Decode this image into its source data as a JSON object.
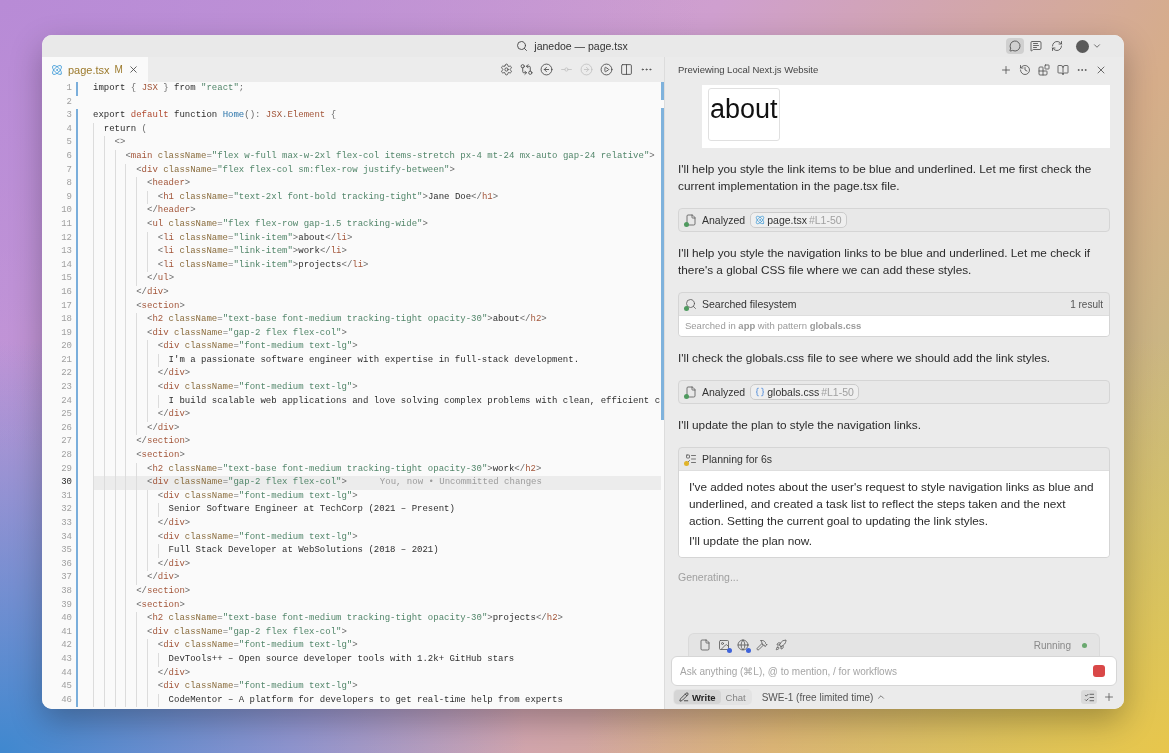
{
  "title_bar": {
    "title": "janedoe — page.tsx",
    "toggles": [
      {
        "selected": true
      },
      {
        "selected": false
      },
      {
        "selected": false
      }
    ]
  },
  "editor": {
    "tabs": [
      {
        "label": "page.tsx",
        "status": "M",
        "modified": true,
        "selected": true
      }
    ],
    "actions": [
      {
        "disabled": false
      },
      {
        "disabled": false
      },
      {
        "disabled": false
      },
      {
        "disabled": true
      },
      {
        "disabled": true
      },
      {
        "disabled": false
      },
      {
        "disabled": false
      },
      {
        "disabled": false
      }
    ],
    "lines": [
      {
        "number": "1",
        "changed": true,
        "current": false,
        "tokens": [
          {
            "kind": "text",
            "text": "import "
          },
          {
            "kind": "punct",
            "text": "{ "
          },
          {
            "kind": "type",
            "text": "JSX"
          },
          {
            "kind": "punct",
            "text": " } "
          },
          {
            "kind": "text",
            "text": "from "
          },
          {
            "kind": "string",
            "text": "\"react\""
          },
          {
            "kind": "punct",
            "text": ";"
          }
        ]
      },
      {
        "number": "2",
        "changed": false,
        "current": false
      },
      {
        "number": "3",
        "changed": true,
        "current": false,
        "tokens": [
          {
            "kind": "text",
            "text": "export "
          },
          {
            "kind": "keyword",
            "text": "default"
          },
          {
            "kind": "text",
            "text": " function "
          },
          {
            "kind": "name",
            "text": "Home"
          },
          {
            "kind": "punct",
            "text": "(): "
          },
          {
            "kind": "type",
            "text": "JSX"
          },
          {
            "kind": "punct",
            "text": "."
          },
          {
            "kind": "type",
            "text": "Element"
          },
          {
            "kind": "punct",
            "text": " {"
          }
        ]
      },
      {
        "number": "4",
        "changed": true,
        "current": false,
        "tokens": [
          {
            "kind": "text",
            "text": "  return "
          },
          {
            "kind": "punct",
            "text": "("
          }
        ]
      },
      {
        "number": "5",
        "changed": true,
        "current": false,
        "tokens": [
          {
            "kind": "punct",
            "text": "    <>"
          }
        ]
      },
      {
        "number": "6",
        "changed": true,
        "current": false,
        "tokens": [
          {
            "kind": "punct",
            "text": "      <"
          },
          {
            "kind": "tag",
            "text": "main"
          },
          {
            "kind": "attr",
            "text": " className"
          },
          {
            "kind": "punct",
            "text": "="
          },
          {
            "kind": "string",
            "text": "\"flex w-full max-w-2xl flex-col items-stretch px-4 mt-24 mx-auto gap-24 relative\""
          },
          {
            "kind": "punct",
            "text": ">"
          }
        ]
      },
      {
        "number": "7",
        "changed": true,
        "current": false,
        "tokens": [
          {
            "kind": "punct",
            "text": "        <"
          },
          {
            "kind": "tag",
            "text": "div"
          },
          {
            "kind": "attr",
            "text": " className"
          },
          {
            "kind": "punct",
            "text": "="
          },
          {
            "kind": "string",
            "text": "\"flex flex-col sm:flex-row justify-between\""
          },
          {
            "kind": "punct",
            "text": ">"
          }
        ]
      },
      {
        "number": "8",
        "changed": true,
        "current": false,
        "tokens": [
          {
            "kind": "punct",
            "text": "          <"
          },
          {
            "kind": "tag",
            "text": "header"
          },
          {
            "kind": "punct",
            "text": ">"
          }
        ]
      },
      {
        "number": "9",
        "changed": true,
        "current": false,
        "tokens": [
          {
            "kind": "punct",
            "text": "            <"
          },
          {
            "kind": "tag",
            "text": "h1"
          },
          {
            "kind": "attr",
            "text": " className"
          },
          {
            "kind": "punct",
            "text": "="
          },
          {
            "kind": "string",
            "text": "\"text-2xl font-bold tracking-tight\""
          },
          {
            "kind": "punct",
            "text": ">"
          },
          {
            "kind": "text",
            "text": "Jane Doe"
          },
          {
            "kind": "punct",
            "text": "</"
          },
          {
            "kind": "tag",
            "text": "h1"
          },
          {
            "kind": "punct",
            "text": ">"
          }
        ]
      },
      {
        "number": "10",
        "changed": true,
        "current": false,
        "tokens": [
          {
            "kind": "punct",
            "text": "          </"
          },
          {
            "kind": "tag",
            "text": "header"
          },
          {
            "kind": "punct",
            "text": ">"
          }
        ]
      },
      {
        "number": "11",
        "changed": true,
        "current": false,
        "tokens": [
          {
            "kind": "punct",
            "text": "          <"
          },
          {
            "kind": "tag",
            "text": "ul"
          },
          {
            "kind": "attr",
            "text": " className"
          },
          {
            "kind": "punct",
            "text": "="
          },
          {
            "kind": "string",
            "text": "\"flex flex-row gap-1.5 tracking-wide\""
          },
          {
            "kind": "punct",
            "text": ">"
          }
        ]
      },
      {
        "number": "12",
        "changed": true,
        "current": false,
        "tokens": [
          {
            "kind": "punct",
            "text": "            <"
          },
          {
            "kind": "tag",
            "text": "li"
          },
          {
            "kind": "attr",
            "text": " className"
          },
          {
            "kind": "punct",
            "text": "="
          },
          {
            "kind": "string",
            "text": "\"link-item\""
          },
          {
            "kind": "punct",
            "text": ">"
          },
          {
            "kind": "text",
            "text": "about"
          },
          {
            "kind": "punct",
            "text": "</"
          },
          {
            "kind": "tag",
            "text": "li"
          },
          {
            "kind": "punct",
            "text": ">"
          }
        ]
      },
      {
        "number": "13",
        "changed": true,
        "current": false,
        "tokens": [
          {
            "kind": "punct",
            "text": "            <"
          },
          {
            "kind": "tag",
            "text": "li"
          },
          {
            "kind": "attr",
            "text": " className"
          },
          {
            "kind": "punct",
            "text": "="
          },
          {
            "kind": "string",
            "text": "\"link-item\""
          },
          {
            "kind": "punct",
            "text": ">"
          },
          {
            "kind": "text",
            "text": "work"
          },
          {
            "kind": "punct",
            "text": "</"
          },
          {
            "kind": "tag",
            "text": "li"
          },
          {
            "kind": "punct",
            "text": ">"
          }
        ]
      },
      {
        "number": "14",
        "changed": true,
        "current": false,
        "tokens": [
          {
            "kind": "punct",
            "text": "            <"
          },
          {
            "kind": "tag",
            "text": "li"
          },
          {
            "kind": "attr",
            "text": " className"
          },
          {
            "kind": "punct",
            "text": "="
          },
          {
            "kind": "string",
            "text": "\"link-item\""
          },
          {
            "kind": "punct",
            "text": ">"
          },
          {
            "kind": "text",
            "text": "projects"
          },
          {
            "kind": "punct",
            "text": "</"
          },
          {
            "kind": "tag",
            "text": "li"
          },
          {
            "kind": "punct",
            "text": ">"
          }
        ]
      },
      {
        "number": "15",
        "changed": true,
        "current": false,
        "tokens": [
          {
            "kind": "punct",
            "text": "          </"
          },
          {
            "kind": "tag",
            "text": "ul"
          },
          {
            "kind": "punct",
            "text": ">"
          }
        ]
      },
      {
        "number": "16",
        "changed": true,
        "current": false,
        "tokens": [
          {
            "kind": "punct",
            "text": "        </"
          },
          {
            "kind": "tag",
            "text": "div"
          },
          {
            "kind": "punct",
            "text": ">"
          }
        ]
      },
      {
        "number": "17",
        "changed": true,
        "current": false,
        "tokens": [
          {
            "kind": "punct",
            "text": "        <"
          },
          {
            "kind": "tag",
            "text": "section"
          },
          {
            "kind": "punct",
            "text": ">"
          }
        ]
      },
      {
        "number": "18",
        "changed": true,
        "current": false,
        "tokens": [
          {
            "kind": "punct",
            "text": "          <"
          },
          {
            "kind": "tag",
            "text": "h2"
          },
          {
            "kind": "attr",
            "text": " className"
          },
          {
            "kind": "punct",
            "text": "="
          },
          {
            "kind": "string",
            "text": "\"text-base font-medium tracking-tight opacity-30\""
          },
          {
            "kind": "punct",
            "text": ">"
          },
          {
            "kind": "text",
            "text": "about"
          },
          {
            "kind": "punct",
            "text": "</"
          },
          {
            "kind": "tag",
            "text": "h2"
          },
          {
            "kind": "punct",
            "text": ">"
          }
        ]
      },
      {
        "number": "19",
        "changed": true,
        "current": false,
        "tokens": [
          {
            "kind": "punct",
            "text": "          <"
          },
          {
            "kind": "tag",
            "text": "div"
          },
          {
            "kind": "attr",
            "text": " className"
          },
          {
            "kind": "punct",
            "text": "="
          },
          {
            "kind": "string",
            "text": "\"gap-2 flex flex-col\""
          },
          {
            "kind": "punct",
            "text": ">"
          }
        ]
      },
      {
        "number": "20",
        "changed": true,
        "current": false,
        "tokens": [
          {
            "kind": "punct",
            "text": "            <"
          },
          {
            "kind": "tag",
            "text": "div"
          },
          {
            "kind": "attr",
            "text": " className"
          },
          {
            "kind": "punct",
            "text": "="
          },
          {
            "kind": "string",
            "text": "\"font-medium text-lg\""
          },
          {
            "kind": "punct",
            "text": ">"
          }
        ]
      },
      {
        "number": "21",
        "changed": true,
        "current": false,
        "tokens": [
          {
            "kind": "text",
            "text": "              I'm a passionate software engineer with expertise in full-stack development."
          }
        ]
      },
      {
        "number": "22",
        "changed": true,
        "current": false,
        "tokens": [
          {
            "kind": "punct",
            "text": "            </"
          },
          {
            "kind": "tag",
            "text": "div"
          },
          {
            "kind": "punct",
            "text": ">"
          }
        ]
      },
      {
        "number": "23",
        "changed": true,
        "current": false,
        "tokens": [
          {
            "kind": "punct",
            "text": "            <"
          },
          {
            "kind": "tag",
            "text": "div"
          },
          {
            "kind": "attr",
            "text": " className"
          },
          {
            "kind": "punct",
            "text": "="
          },
          {
            "kind": "string",
            "text": "\"font-medium text-lg\""
          },
          {
            "kind": "punct",
            "text": ">"
          }
        ]
      },
      {
        "number": "24",
        "changed": true,
        "current": false,
        "tokens": [
          {
            "kind": "text",
            "text": "              I build scalable web applications and love solving complex problems with clean, efficient c"
          }
        ]
      },
      {
        "number": "25",
        "changed": true,
        "current": false,
        "tokens": [
          {
            "kind": "punct",
            "text": "            </"
          },
          {
            "kind": "tag",
            "text": "div"
          },
          {
            "kind": "punct",
            "text": ">"
          }
        ]
      },
      {
        "number": "26",
        "changed": true,
        "current": false,
        "tokens": [
          {
            "kind": "punct",
            "text": "          </"
          },
          {
            "kind": "tag",
            "text": "div"
          },
          {
            "kind": "punct",
            "text": ">"
          }
        ]
      },
      {
        "number": "27",
        "changed": true,
        "current": false,
        "tokens": [
          {
            "kind": "punct",
            "text": "        </"
          },
          {
            "kind": "tag",
            "text": "section"
          },
          {
            "kind": "punct",
            "text": ">"
          }
        ]
      },
      {
        "number": "28",
        "changed": true,
        "current": false,
        "tokens": [
          {
            "kind": "punct",
            "text": "        <"
          },
          {
            "kind": "tag",
            "text": "section"
          },
          {
            "kind": "punct",
            "text": ">"
          }
        ]
      },
      {
        "number": "29",
        "changed": true,
        "current": false,
        "tokens": [
          {
            "kind": "punct",
            "text": "          <"
          },
          {
            "kind": "tag",
            "text": "h2"
          },
          {
            "kind": "attr",
            "text": " className"
          },
          {
            "kind": "punct",
            "text": "="
          },
          {
            "kind": "string",
            "text": "\"text-base font-medium tracking-tight opacity-30\""
          },
          {
            "kind": "punct",
            "text": ">"
          },
          {
            "kind": "text",
            "text": "work"
          },
          {
            "kind": "punct",
            "text": "</"
          },
          {
            "kind": "tag",
            "text": "h2"
          },
          {
            "kind": "punct",
            "text": ">"
          }
        ]
      },
      {
        "number": "30",
        "changed": true,
        "current": true,
        "blame": "You, now • Uncommitted changes",
        "tokens": [
          {
            "kind": "punct",
            "text": "          <"
          },
          {
            "kind": "tag",
            "text": "div"
          },
          {
            "kind": "attr",
            "text": " className"
          },
          {
            "kind": "punct",
            "text": "="
          },
          {
            "kind": "string",
            "text": "\"gap-2 flex flex-col\""
          },
          {
            "kind": "punct",
            "text": ">"
          }
        ]
      },
      {
        "number": "31",
        "changed": true,
        "current": false,
        "tokens": [
          {
            "kind": "punct",
            "text": "            <"
          },
          {
            "kind": "tag",
            "text": "div"
          },
          {
            "kind": "attr",
            "text": " className"
          },
          {
            "kind": "punct",
            "text": "="
          },
          {
            "kind": "string",
            "text": "\"font-medium text-lg\""
          },
          {
            "kind": "punct",
            "text": ">"
          }
        ]
      },
      {
        "number": "32",
        "changed": true,
        "current": false,
        "tokens": [
          {
            "kind": "text",
            "text": "              Senior Software Engineer at TechCorp (2021 – Present)"
          }
        ]
      },
      {
        "number": "33",
        "changed": true,
        "current": false,
        "tokens": [
          {
            "kind": "punct",
            "text": "            </"
          },
          {
            "kind": "tag",
            "text": "div"
          },
          {
            "kind": "punct",
            "text": ">"
          }
        ]
      },
      {
        "number": "34",
        "changed": true,
        "current": false,
        "tokens": [
          {
            "kind": "punct",
            "text": "            <"
          },
          {
            "kind": "tag",
            "text": "div"
          },
          {
            "kind": "attr",
            "text": " className"
          },
          {
            "kind": "punct",
            "text": "="
          },
          {
            "kind": "string",
            "text": "\"font-medium text-lg\""
          },
          {
            "kind": "punct",
            "text": ">"
          }
        ]
      },
      {
        "number": "35",
        "changed": true,
        "current": false,
        "tokens": [
          {
            "kind": "text",
            "text": "              Full Stack Developer at WebSolutions (2018 – 2021)"
          }
        ]
      },
      {
        "number": "36",
        "changed": true,
        "current": false,
        "tokens": [
          {
            "kind": "punct",
            "text": "            </"
          },
          {
            "kind": "tag",
            "text": "div"
          },
          {
            "kind": "punct",
            "text": ">"
          }
        ]
      },
      {
        "number": "37",
        "changed": true,
        "current": false,
        "tokens": [
          {
            "kind": "punct",
            "text": "          </"
          },
          {
            "kind": "tag",
            "text": "div"
          },
          {
            "kind": "punct",
            "text": ">"
          }
        ]
      },
      {
        "number": "38",
        "changed": true,
        "current": false,
        "tokens": [
          {
            "kind": "punct",
            "text": "        </"
          },
          {
            "kind": "tag",
            "text": "section"
          },
          {
            "kind": "punct",
            "text": ">"
          }
        ]
      },
      {
        "number": "39",
        "changed": true,
        "current": false,
        "tokens": [
          {
            "kind": "punct",
            "text": "        <"
          },
          {
            "kind": "tag",
            "text": "section"
          },
          {
            "kind": "punct",
            "text": ">"
          }
        ]
      },
      {
        "number": "40",
        "changed": true,
        "current": false,
        "tokens": [
          {
            "kind": "punct",
            "text": "          <"
          },
          {
            "kind": "tag",
            "text": "h2"
          },
          {
            "kind": "attr",
            "text": " className"
          },
          {
            "kind": "punct",
            "text": "="
          },
          {
            "kind": "string",
            "text": "\"text-base font-medium tracking-tight opacity-30\""
          },
          {
            "kind": "punct",
            "text": ">"
          },
          {
            "kind": "text",
            "text": "projects"
          },
          {
            "kind": "punct",
            "text": "</"
          },
          {
            "kind": "tag",
            "text": "h2"
          },
          {
            "kind": "punct",
            "text": ">"
          }
        ]
      },
      {
        "number": "41",
        "changed": true,
        "current": false,
        "tokens": [
          {
            "kind": "punct",
            "text": "          <"
          },
          {
            "kind": "tag",
            "text": "div"
          },
          {
            "kind": "attr",
            "text": " className"
          },
          {
            "kind": "punct",
            "text": "="
          },
          {
            "kind": "string",
            "text": "\"gap-2 flex flex-col\""
          },
          {
            "kind": "punct",
            "text": ">"
          }
        ]
      },
      {
        "number": "42",
        "changed": true,
        "current": false,
        "tokens": [
          {
            "kind": "punct",
            "text": "            <"
          },
          {
            "kind": "tag",
            "text": "div"
          },
          {
            "kind": "attr",
            "text": " className"
          },
          {
            "kind": "punct",
            "text": "="
          },
          {
            "kind": "string",
            "text": "\"font-medium text-lg\""
          },
          {
            "kind": "punct",
            "text": ">"
          }
        ]
      },
      {
        "number": "43",
        "changed": true,
        "current": false,
        "tokens": [
          {
            "kind": "text",
            "text": "              DevTools++ – Open source developer tools with 1.2k+ GitHub stars"
          }
        ]
      },
      {
        "number": "44",
        "changed": true,
        "current": false,
        "tokens": [
          {
            "kind": "punct",
            "text": "            </"
          },
          {
            "kind": "tag",
            "text": "div"
          },
          {
            "kind": "punct",
            "text": ">"
          }
        ]
      },
      {
        "number": "45",
        "changed": true,
        "current": false,
        "tokens": [
          {
            "kind": "punct",
            "text": "            <"
          },
          {
            "kind": "tag",
            "text": "div"
          },
          {
            "kind": "attr",
            "text": " className"
          },
          {
            "kind": "punct",
            "text": "="
          },
          {
            "kind": "string",
            "text": "\"font-medium text-lg\""
          },
          {
            "kind": "punct",
            "text": ">"
          }
        ]
      },
      {
        "number": "46",
        "changed": true,
        "current": false,
        "tokens": [
          {
            "kind": "text",
            "text": "              CodeMentor – A platform for developers to get real-time help from experts"
          }
        ]
      }
    ]
  },
  "panel": {
    "title": "Previewing Local Next.js Website",
    "preview": {
      "text": "about"
    },
    "messages": [
      {
        "kind": "text",
        "text": "I'll help you style the link items to be blue and underlined. Let me first check the current implementation in the page.tsx file."
      },
      {
        "kind": "file",
        "label": "Analyzed",
        "color": "#4f9a5f",
        "file": {
          "kind": "tsx",
          "name": "page.tsx",
          "range": "#L1-50"
        }
      },
      {
        "kind": "text",
        "text": "I'll help you style the navigation links to be blue and underlined. Let me check if there's a global CSS file where we can add these styles."
      },
      {
        "kind": "search",
        "label": "Searched filesystem",
        "color": "#4f9a5f",
        "count": "1 result",
        "detail": "Searched in **app** with pattern **globals.css**"
      },
      {
        "kind": "text",
        "text": "I'll check the globals.css file to see where we should add the link styles."
      },
      {
        "kind": "file",
        "label": "Analyzed",
        "color": "#4f9a5f",
        "file": {
          "kind": "css",
          "name": "globals.css",
          "range": "#L1-50"
        }
      },
      {
        "kind": "text",
        "text": "I'll update the plan to style the navigation links."
      },
      {
        "kind": "plan",
        "label": "Planning for 6s",
        "color": "#e0b42a",
        "paragraphs": [
          "I've added notes about the user's request to style navigation links as blue and underlined, and created a task list to reflect the steps taken and the next action. Setting the current goal to updating the link styles.",
          "I'll update the plan now."
        ]
      }
    ],
    "status": "Generating...",
    "composer": {
      "tools": [
        {
          "enabled": false
        },
        {
          "enabled": true
        },
        {
          "enabled": true
        },
        {
          "enabled": false
        },
        {
          "enabled": false
        }
      ],
      "run_status": "Running",
      "placeholder": "Ask anything (⌘L), @ to mention, / for workflows"
    },
    "modes": [
      {
        "label": "Write",
        "selected": true
      },
      {
        "label": "Chat",
        "selected": false
      }
    ],
    "model": "SWE-1 (free limited time)"
  }
}
